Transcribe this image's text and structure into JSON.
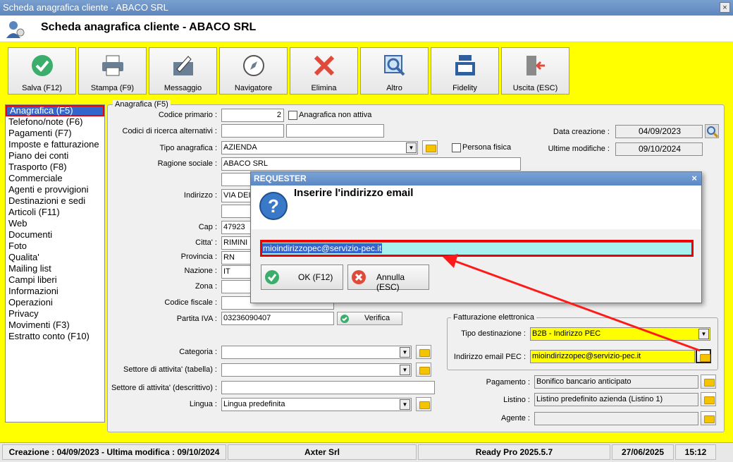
{
  "window": {
    "title": "Scheda anagrafica cliente - ABACO SRL",
    "close": "×"
  },
  "header": {
    "title": "Scheda anagrafica cliente - ABACO SRL"
  },
  "toolbar": [
    {
      "label": "Salva (F12)",
      "icon": "check-icon"
    },
    {
      "label": "Stampa (F9)",
      "icon": "printer-icon"
    },
    {
      "label": "Messaggio",
      "icon": "message-icon"
    },
    {
      "label": "Navigatore",
      "icon": "compass-icon"
    },
    {
      "label": "Elimina",
      "icon": "delete-icon"
    },
    {
      "label": "Altro",
      "icon": "magnifier-icon"
    },
    {
      "label": "Fidelity",
      "icon": "register-icon"
    },
    {
      "label": "Uscita (ESC)",
      "icon": "exit-icon"
    }
  ],
  "sidebar": [
    "Anagrafica (F5)",
    "Telefono/note (F6)",
    "Pagamenti (F7)",
    "Imposte e fatturazione",
    "Piano dei conti",
    "Trasporto (F8)",
    "Commerciale",
    "Agenti e provvigioni",
    "Destinazioni e sedi",
    "Articoli (F11)",
    "Web",
    "Documenti",
    "Foto",
    "Qualita'",
    "Mailing list",
    "Campi liberi",
    "Informazioni",
    "Operazioni",
    "Privacy",
    "Movimenti (F3)",
    "Estratto conto (F10)"
  ],
  "form": {
    "legend": "Anagrafica (F5)",
    "codice_primario_label": "Codice primario :",
    "codice_primario": "2",
    "non_attiva_label": "Anagrafica non attiva",
    "codici_alt_label": "Codici di ricerca alternativi :",
    "tipo_label": "Tipo anagrafica :",
    "tipo": "AZIENDA",
    "persona_fisica_label": "Persona fisica",
    "ragione_label": "Ragione sociale :",
    "ragione": "ABACO SRL",
    "indirizzo_label": "Indirizzo :",
    "indirizzo": "VIA DEI",
    "cap_label": "Cap :",
    "cap": "47923",
    "citta_label": "Citta' :",
    "citta": "RIMINI",
    "provincia_label": "Provincia :",
    "provincia": "RN",
    "nazione_label": "Nazione :",
    "nazione": "IT",
    "zona_label": "Zona :",
    "cf_label": "Codice fiscale :",
    "piva_label": "Partita IVA :",
    "piva": "03236090407",
    "verifica": "Verifica",
    "categoria_label": "Categoria :",
    "settore_tab_label": "Settore di attivita' (tabella) :",
    "settore_desc_label": "Settore di attivita' (descrittivo) :",
    "lingua_label": "Lingua :",
    "lingua": "Lingua predefinita",
    "data_creazione_label": "Data creazione :",
    "data_creazione": "04/09/2023",
    "ultime_modifiche_label": "Ultime modifiche :",
    "ultime_modifiche": "09/10/2024",
    "fe_legend": "Fatturazione elettronica",
    "tipo_dest_label": "Tipo destinazione :",
    "tipo_dest": "B2B - Indirizzo PEC",
    "pec_label": "Indirizzo email PEC :",
    "pec": "mioindirizzopec@servizio-pec.it",
    "pagamento_label": "Pagamento :",
    "pagamento": "Bonifico bancario anticipato",
    "listino_label": "Listino :",
    "listino": "Listino predefinito azienda (Listino 1)",
    "agente_label": "Agente :"
  },
  "dialog": {
    "title": "REQUESTER",
    "close": "×",
    "message": "Inserire l'indirizzo email",
    "value": "mioindirizzopec@servizio-pec.it",
    "ok": "OK (F12)",
    "cancel": "Annulla (ESC)"
  },
  "status": {
    "dates": "Creazione : 04/09/2023 - Ultima modifica : 09/10/2024",
    "company": "Axter Srl",
    "product": "Ready Pro 2025.5.7",
    "date": "27/06/2025",
    "time": "15:12"
  },
  "colors": {
    "highlight": "#ff0000",
    "background": "#ffff00",
    "accent": "#3266cc"
  }
}
